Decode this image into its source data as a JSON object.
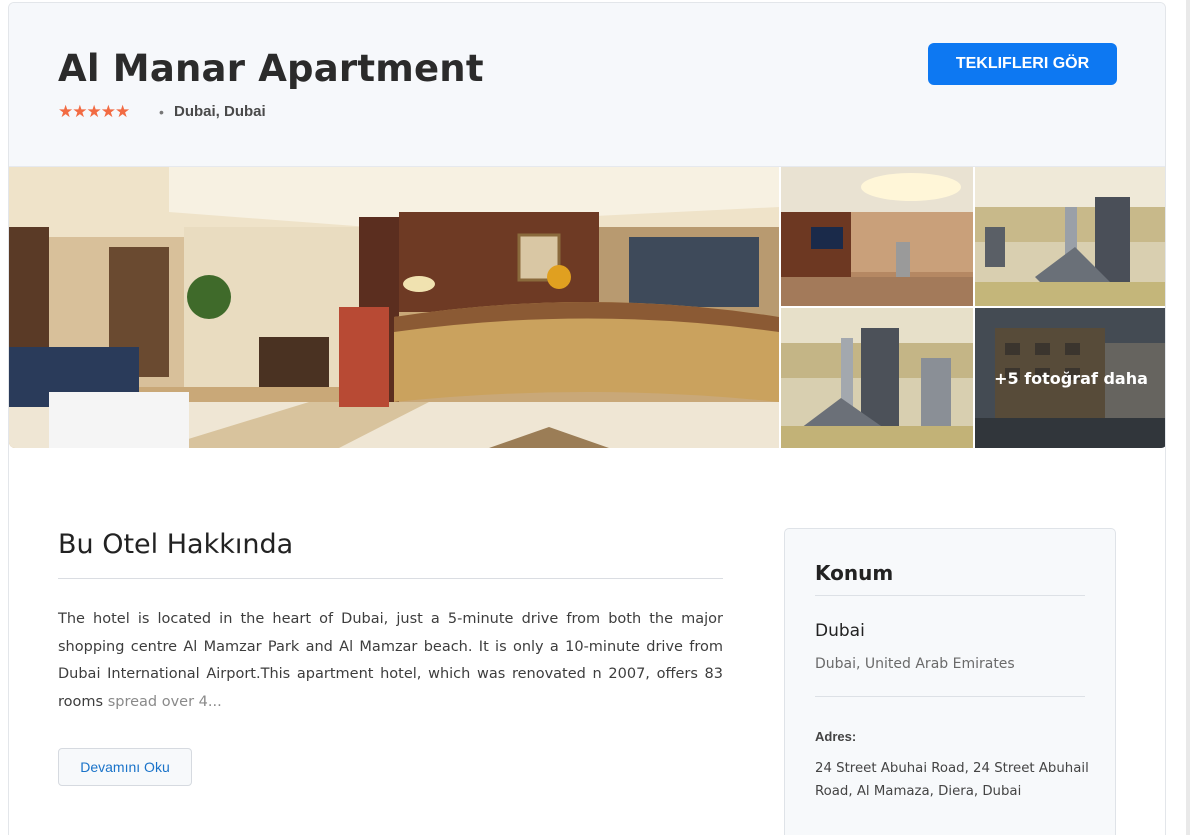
{
  "hotel": {
    "name": "Al Manar Apartment",
    "stars": "★★★★★",
    "location": "Dubai, Dubai",
    "cta_label": "TEKLIFLERI GÖR"
  },
  "gallery": {
    "more_label": "+5 fotoğraf daha",
    "photos": [
      {
        "name": "lobby-reception-photo"
      },
      {
        "name": "lounge-tv-photo"
      },
      {
        "name": "gym-photo-1"
      },
      {
        "name": "gym-photo-2"
      },
      {
        "name": "exterior-photo"
      }
    ]
  },
  "about": {
    "title": "Bu Otel Hakkında",
    "text": "The hotel is located in the heart of Dubai, just a 5-minute drive from both the major shopping centre Al Mamzar Park and Al Mamzar beach. It is only a 10-minute drive from Dubai International Airport.This apartment hotel, which was renovated n 2007, offers 83 rooms",
    "text_fade": "spread over 4...",
    "read_more_label": "Devamını Oku"
  },
  "location_card": {
    "title": "Konum",
    "city": "Dubai",
    "country": "Dubai, United Arab Emirates",
    "address_label": "Adres:",
    "address": "24 Street Abuhai Road, 24 Street Abuhail Road, Al Mamaza, Diera, Dubai"
  },
  "colors": {
    "accent": "#0d78f2",
    "stars": "#f26b43",
    "header_bg": "#f6f8fb"
  }
}
